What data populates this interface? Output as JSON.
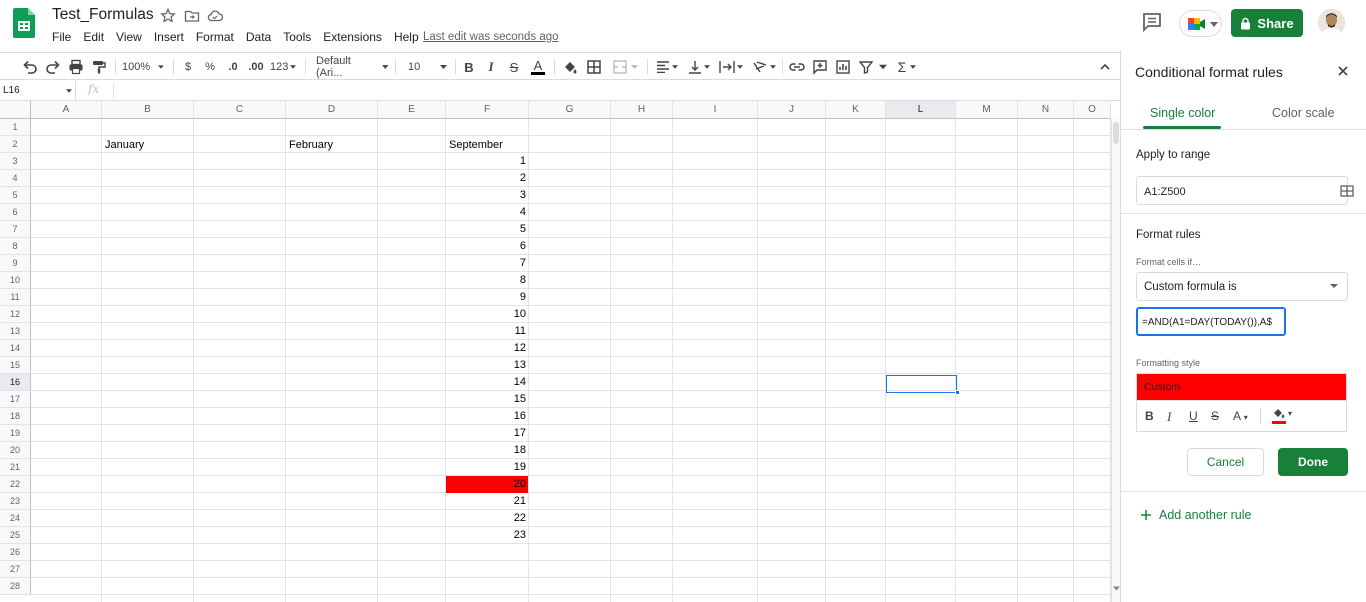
{
  "doc": {
    "title": "Test_Formulas",
    "last_edit": "Last edit was seconds ago"
  },
  "menu": [
    "File",
    "Edit",
    "View",
    "Insert",
    "Format",
    "Data",
    "Tools",
    "Extensions",
    "Help"
  ],
  "header": {
    "share_label": "Share"
  },
  "toolbar": {
    "zoom": "100%",
    "currency": "$",
    "percent": "%",
    "decrease_decimals": ".0",
    "increase_decimals": ".00",
    "more_formats": "123",
    "font": "Default (Ari...",
    "font_size": "10"
  },
  "formula_bar": {
    "name_box": "L16",
    "fx_label": "fx",
    "value": ""
  },
  "grid": {
    "columns": [
      "A",
      "B",
      "C",
      "D",
      "E",
      "F",
      "G",
      "H",
      "I",
      "J",
      "K",
      "L",
      "M",
      "N",
      "O"
    ],
    "rows": [
      "1",
      "2",
      "3",
      "4",
      "5",
      "6",
      "7",
      "8",
      "9",
      "10",
      "11",
      "12",
      "13",
      "14",
      "15",
      "16",
      "17",
      "18",
      "19",
      "20",
      "21",
      "22",
      "23",
      "24",
      "25",
      "26",
      "27",
      "28"
    ],
    "b2": "January",
    "d2": "February",
    "f2": "September",
    "f_values": [
      "1",
      "2",
      "3",
      "4",
      "5",
      "6",
      "7",
      "8",
      "9",
      "10",
      "11",
      "12",
      "13",
      "14",
      "15",
      "16",
      "17",
      "18",
      "19",
      "20",
      "21",
      "22",
      "23"
    ],
    "highlight_color": "#ff0000",
    "selected_cell": "L16"
  },
  "panel": {
    "title": "Conditional format rules",
    "tab_single": "Single color",
    "tab_scale": "Color scale",
    "apply_label": "Apply to range",
    "range": "A1:Z500",
    "rules_label": "Format rules",
    "cells_if_label": "Format cells if…",
    "condition": "Custom formula is",
    "formula": "=AND(A1=DAY(TODAY()),A$",
    "style_label": "Formatting style",
    "style_preview": "Custom",
    "style_color": "#ff0000",
    "cancel": "Cancel",
    "done": "Done",
    "add_rule": "Add another rule"
  },
  "colors": {
    "accent": "#188038",
    "selection": "#1a73e8"
  }
}
